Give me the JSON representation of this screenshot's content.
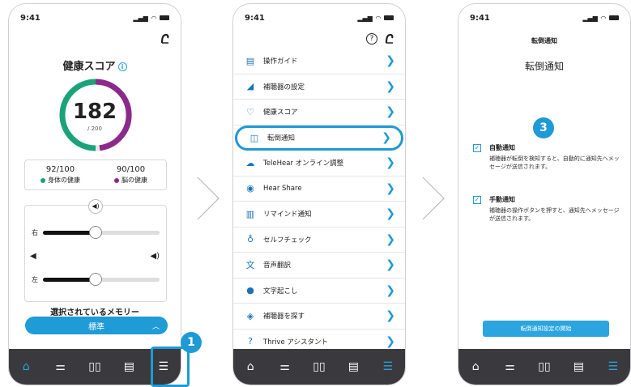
{
  "status": {
    "time": "9:41"
  },
  "screen1": {
    "title": "健康スコア",
    "info_icon": "info-icon",
    "score": "182",
    "score_max": "/ 200",
    "body_score": "92/100",
    "body_label": "身体の健康",
    "brain_score": "90/100",
    "brain_label": "脳の健康",
    "right_label": "右",
    "left_label": "左",
    "right_volume": 0.45,
    "left_volume": 0.45,
    "memory_label": "選択されているメモリー",
    "memory_value": "標準",
    "badge": "1",
    "colors": {
      "accent": "#1f9bd6",
      "body": "#1aa37a",
      "brain": "#8b2a8b"
    }
  },
  "screen2": {
    "menu": [
      {
        "label": "操作ガイド",
        "icon": "book-icon"
      },
      {
        "label": "補聴器の設定",
        "icon": "hearing-aid-icon"
      },
      {
        "label": "健康スコア",
        "icon": "heart-icon"
      },
      {
        "label": "転倒通知",
        "icon": "alert-message-icon"
      },
      {
        "label": "TeleHear オンライン調整",
        "icon": "cloud-icon"
      },
      {
        "label": "Hear Share",
        "icon": "share-person-icon"
      },
      {
        "label": "リマインド通知",
        "icon": "list-icon"
      },
      {
        "label": "セルフチェック",
        "icon": "stethoscope-icon"
      },
      {
        "label": "音声翻訳",
        "icon": "translate-icon"
      },
      {
        "label": "文字起こし",
        "icon": "speaker-person-icon"
      },
      {
        "label": "補聴器を探す",
        "icon": "locate-icon"
      },
      {
        "label": "Thrive アシスタント",
        "icon": "question-icon"
      }
    ]
  },
  "screen3": {
    "header": "転倒通知",
    "title": "転倒通知",
    "badge": "3",
    "auto_title": "自動通知",
    "auto_desc": "補聴器が転倒を検知すると、自動的に通知先へメッセージが送信されます。",
    "manual_title": "手動通知",
    "manual_desc": "補聴器の操作ボタンを押すと、通知先へメッセージが送信されます。",
    "start_button": "転倒通知設定の開始"
  }
}
